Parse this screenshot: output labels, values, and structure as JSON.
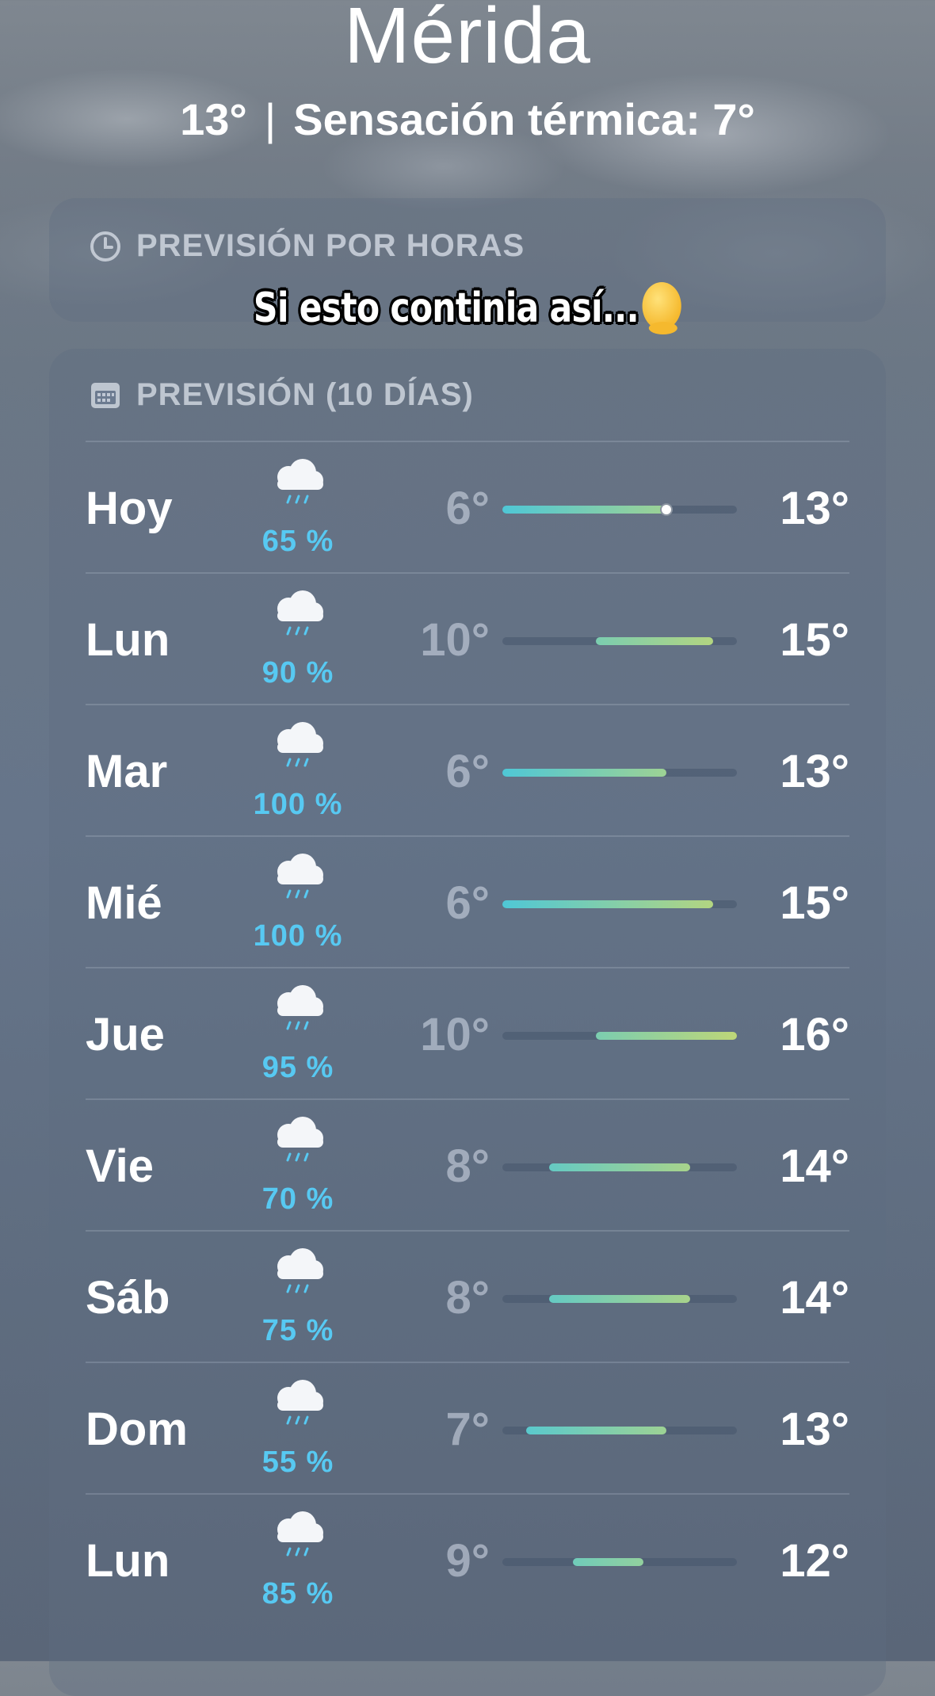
{
  "location": {
    "city": "Mérida",
    "current_temp": "13°",
    "feels_like": "Sensación térmica: 7°"
  },
  "hourly": {
    "header": "PREVISIÓN POR HORAS"
  },
  "overlay": {
    "caption": "Si esto continia así..."
  },
  "daily": {
    "header": "PREVISIÓN (10 DÍAS)",
    "scale": {
      "min": 6,
      "max": 16
    },
    "rows": [
      {
        "day": "Hoy",
        "icon": "rain-cloud-icon",
        "precip": "65 %",
        "low": "6°",
        "high": "13°",
        "low_val": 6,
        "high_val": 13,
        "current_val": 13
      },
      {
        "day": "Lun",
        "icon": "rain-cloud-icon",
        "precip": "90 %",
        "low": "10°",
        "high": "15°",
        "low_val": 10,
        "high_val": 15
      },
      {
        "day": "Mar",
        "icon": "rain-cloud-icon",
        "precip": "100 %",
        "low": "6°",
        "high": "13°",
        "low_val": 6,
        "high_val": 13
      },
      {
        "day": "Mié",
        "icon": "rain-cloud-icon",
        "precip": "100 %",
        "low": "6°",
        "high": "15°",
        "low_val": 6,
        "high_val": 15
      },
      {
        "day": "Jue",
        "icon": "rain-cloud-icon",
        "precip": "95 %",
        "low": "10°",
        "high": "16°",
        "low_val": 10,
        "high_val": 16
      },
      {
        "day": "Vie",
        "icon": "rain-cloud-icon",
        "precip": "70 %",
        "low": "8°",
        "high": "14°",
        "low_val": 8,
        "high_val": 14
      },
      {
        "day": "Sáb",
        "icon": "rain-cloud-icon",
        "precip": "75 %",
        "low": "8°",
        "high": "14°",
        "low_val": 8,
        "high_val": 14
      },
      {
        "day": "Dom",
        "icon": "rain-cloud-icon",
        "precip": "55 %",
        "low": "7°",
        "high": "13°",
        "low_val": 7,
        "high_val": 13
      },
      {
        "day": "Lun",
        "icon": "rain-cloud-icon",
        "precip": "85 %",
        "low": "9°",
        "high": "12°",
        "low_val": 9,
        "high_val": 12
      }
    ]
  },
  "colors": {
    "precip": "#57c9f2",
    "bar_cool": "#4fc7d6",
    "bar_warm": "#a8d48a"
  }
}
